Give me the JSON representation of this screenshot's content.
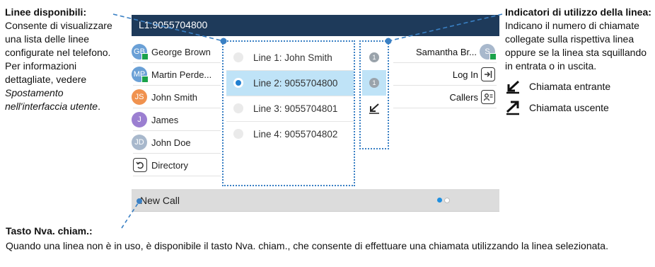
{
  "annotations": {
    "left": {
      "title": "Linee disponibili:",
      "body": "Consente di visualizzare una lista delle linee configurate nel telefono. Per informazioni dettagliate, vedere",
      "reference": "Spostamento nell'interfaccia utente",
      "end": "."
    },
    "right": {
      "title": "Indicatori di utilizzo della linea:",
      "body": "Indicano il numero di chiamate collegate sulla rispettiva linea oppure se la linea sta squillando in entrata o in uscita.",
      "incoming": "Chiamata entrante",
      "outgoing": "Chiamata uscente"
    },
    "bottom": {
      "title": "Tasto Nva. chiam.:",
      "body": "Quando una linea non è in uso, è disponibile il tasto Nva. chiam., che consente di effettuare una chiamata utilizzando la linea selezionata."
    }
  },
  "screen": {
    "topbar_label": "L1:9055704800",
    "programmable_keys": [
      {
        "initials": "GB",
        "name": "George Brown",
        "color": "#6aa0d6",
        "presence": true
      },
      {
        "initials": "MP",
        "name": "Martin Perde...",
        "color": "#6aa0d6",
        "presence": true
      },
      {
        "initials": "JS",
        "name": "John Smith",
        "color": "#f0924f",
        "presence": false
      },
      {
        "initials": "J",
        "name": "James",
        "color": "#9b7fd1",
        "presence": false
      },
      {
        "initials": "JD",
        "name": "John Doe",
        "color": "#a8b8cc",
        "presence": false
      }
    ],
    "directory_label": "Directory",
    "lines": [
      {
        "label": "Line 1: John Smith",
        "selected": false
      },
      {
        "label": "Line 2: 9055704800",
        "selected": true
      },
      {
        "label": "Line 3: 9055704801",
        "selected": false
      },
      {
        "label": "Line 4: 9055704802",
        "selected": false
      }
    ],
    "indicators": [
      {
        "type": "count",
        "value": "1"
      },
      {
        "type": "count",
        "value": "1"
      },
      {
        "type": "incoming-icon"
      }
    ],
    "right_keys": {
      "contact": {
        "name": "Samantha Br...",
        "initials": "S",
        "color": "#a8b8cc",
        "presence": true
      },
      "login": "Log In",
      "callers": "Callers"
    },
    "softkey": "New Call",
    "page_dots": {
      "active": "#1f8fe0",
      "inactive": "#ffffff"
    },
    "accent_color": "#3a80c4",
    "topbar_color": "#1e3a5a"
  }
}
